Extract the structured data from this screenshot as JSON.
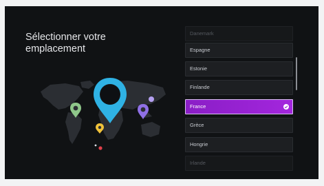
{
  "screen": {
    "title_line1": "Sélectionner votre",
    "title_line2": "emplacement"
  },
  "countries": [
    {
      "label": "Danemark",
      "state": "faded"
    },
    {
      "label": "Espagne",
      "state": "normal"
    },
    {
      "label": "Estonie",
      "state": "normal"
    },
    {
      "label": "Finlande",
      "state": "normal"
    },
    {
      "label": "France",
      "state": "selected"
    },
    {
      "label": "Grèce",
      "state": "normal"
    },
    {
      "label": "Hongrie",
      "state": "normal"
    },
    {
      "label": "Irlande",
      "state": "faded"
    }
  ],
  "colors": {
    "selected_start": "#8a1ec6",
    "selected_end": "#a326dd",
    "pin_main": "#2fb2e4",
    "pin_green": "#8fc78a",
    "pin_purple": "#8f70e6",
    "pin_yellow": "#f0c23a",
    "dot_red": "#e0404b",
    "dot_lilac": "#b4a0f0"
  },
  "icons": {
    "main_pin": "location-pin-icon",
    "check": "check-circle-icon"
  }
}
